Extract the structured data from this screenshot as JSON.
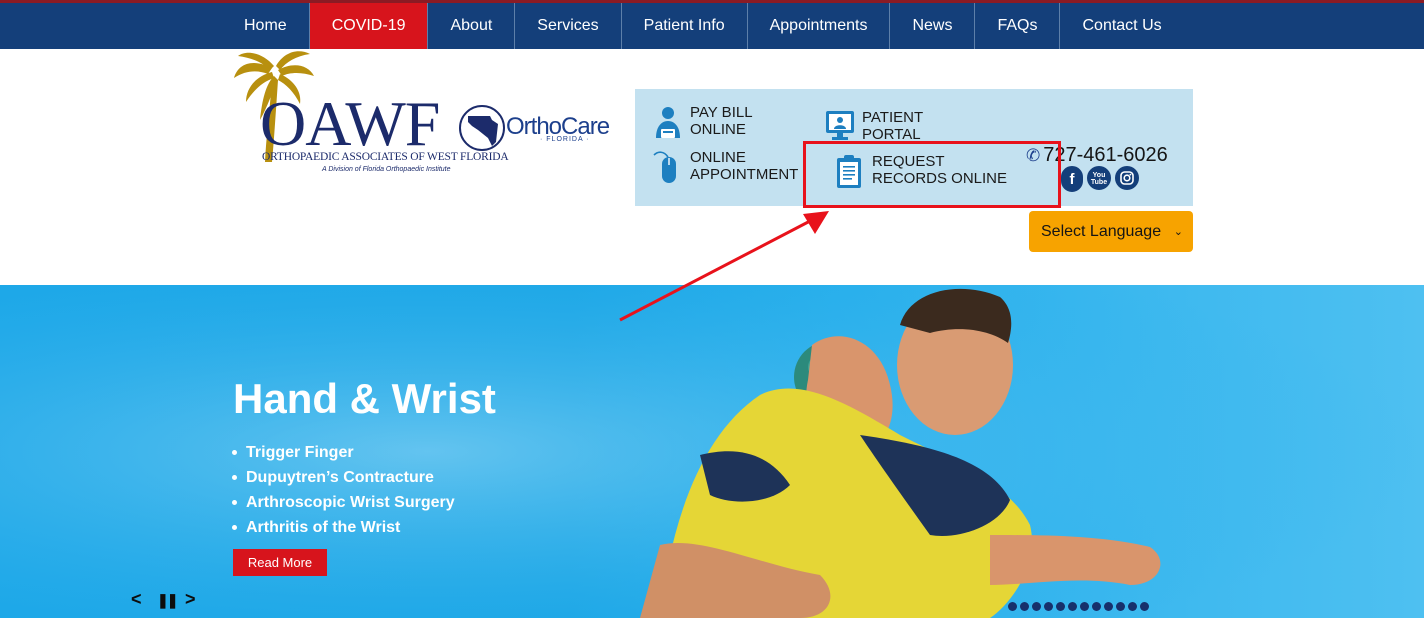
{
  "nav": {
    "items": [
      {
        "label": "Home",
        "active": false
      },
      {
        "label": "COVID-19",
        "active": true
      },
      {
        "label": "About",
        "active": false
      },
      {
        "label": "Services",
        "active": false
      },
      {
        "label": "Patient Info",
        "active": false
      },
      {
        "label": "Appointments",
        "active": false
      },
      {
        "label": "News",
        "active": false
      },
      {
        "label": "FAQs",
        "active": false
      },
      {
        "label": "Contact Us",
        "active": false
      }
    ]
  },
  "logo": {
    "name": "OAWF",
    "full_name": "ORTHOPAEDIC ASSOCIATES OF WEST FLORIDA",
    "division": "A Division of Florida Orthopaedic Institute",
    "partner": "OrthoCare",
    "partner_region": "· FLORIDA ·"
  },
  "quick_links": {
    "pay_bill": {
      "line1": "PAY BILL",
      "line2": "ONLINE",
      "icon": "person-card-icon"
    },
    "patient_portal": {
      "line1": "PATIENT",
      "line2": "PORTAL",
      "icon": "monitor-icon"
    },
    "online_appointment": {
      "line1": "ONLINE",
      "line2": "APPOINTMENT",
      "icon": "mouse-icon"
    },
    "request_records": {
      "line1": "REQUEST",
      "line2": "RECORDS ONLINE",
      "icon": "clipboard-icon"
    }
  },
  "contact": {
    "phone": "727-461-6026",
    "social": [
      "facebook-icon",
      "youtube-icon",
      "instagram-icon"
    ],
    "youtube_label": "You Tube"
  },
  "language": {
    "selected": "Select Language"
  },
  "hero": {
    "title": "Hand & Wrist",
    "items": [
      "Trigger Finger",
      "Dupuytren’s Contracture",
      "Arthroscopic Wrist Surgery",
      "Arthritis of the Wrist"
    ],
    "cta": "Read More",
    "prev": "<",
    "pause": "❚❚",
    "next": ">",
    "slide_count": 12
  },
  "colors": {
    "nav_bg": "#143f7a",
    "nav_active": "#d7141c",
    "quick_box": "#c3e1f0",
    "language_bg": "#f7a300",
    "hero_bg": "#1ba7e8",
    "annotation": "#e8121b"
  }
}
